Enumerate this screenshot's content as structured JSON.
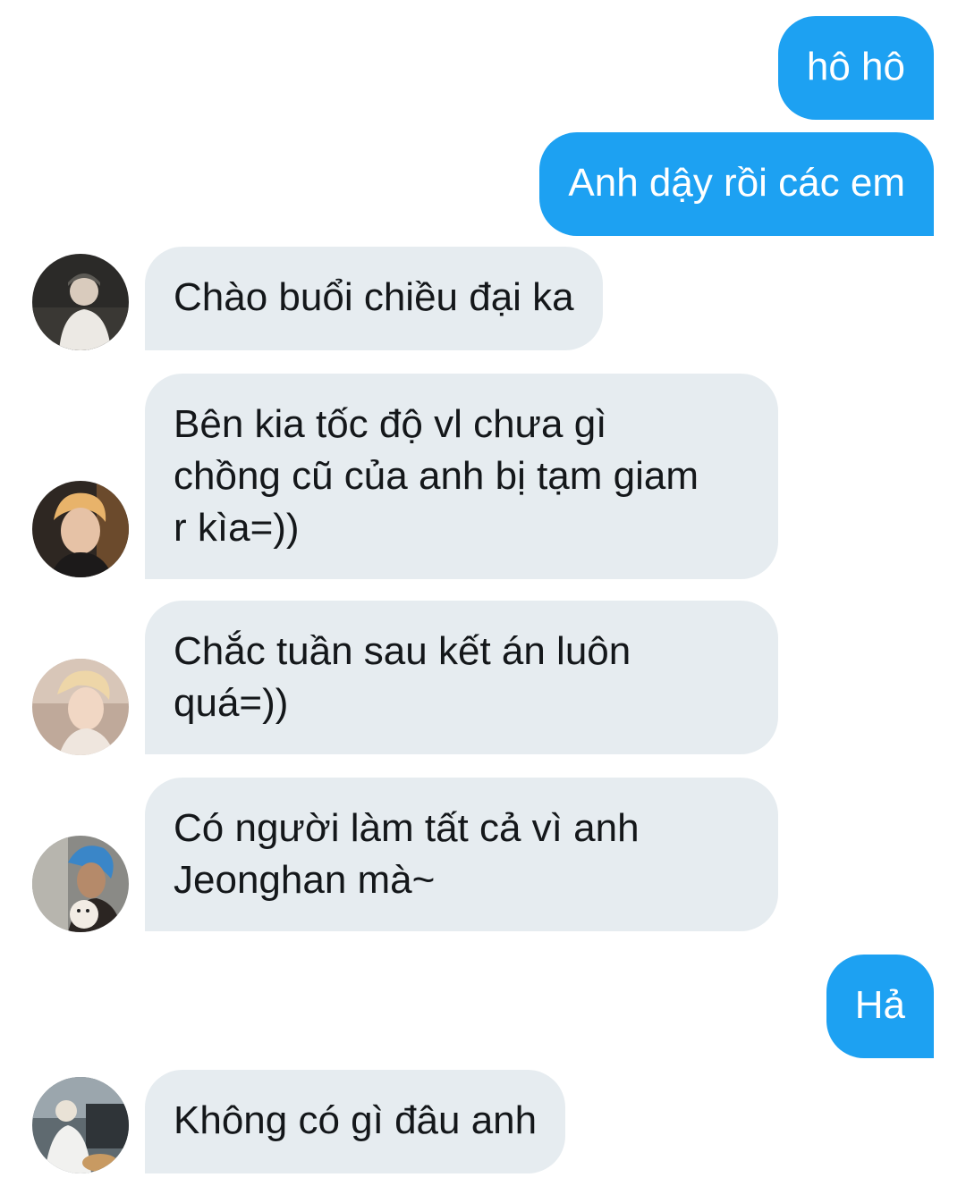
{
  "colors": {
    "outgoing_bubble": "#1da1f2",
    "incoming_bubble": "#e6ecf0",
    "outgoing_text": "#ffffff",
    "incoming_text": "#14171a"
  },
  "messages": [
    {
      "direction": "outgoing",
      "text": "hô hô"
    },
    {
      "direction": "outgoing",
      "text": "Anh dậy rồi các em"
    },
    {
      "direction": "incoming",
      "avatar": "avatar-photo",
      "text": "Chào buổi chiều đại ka"
    },
    {
      "direction": "incoming",
      "avatar": "avatar-photo",
      "text": "Bên kia tốc độ vl chưa gì\nchồng cũ của anh bị tạm giam\nr kìa=))"
    },
    {
      "direction": "incoming",
      "avatar": "avatar-photo",
      "text": "Chắc tuần sau kết án luôn\nquá=))"
    },
    {
      "direction": "incoming",
      "avatar": "avatar-photo",
      "text": "Có người làm tất cả vì anh\nJeonghan mà~"
    },
    {
      "direction": "outgoing",
      "text": "Hả"
    },
    {
      "direction": "incoming",
      "avatar": "avatar-photo",
      "text": "Không có gì đâu anh"
    }
  ]
}
